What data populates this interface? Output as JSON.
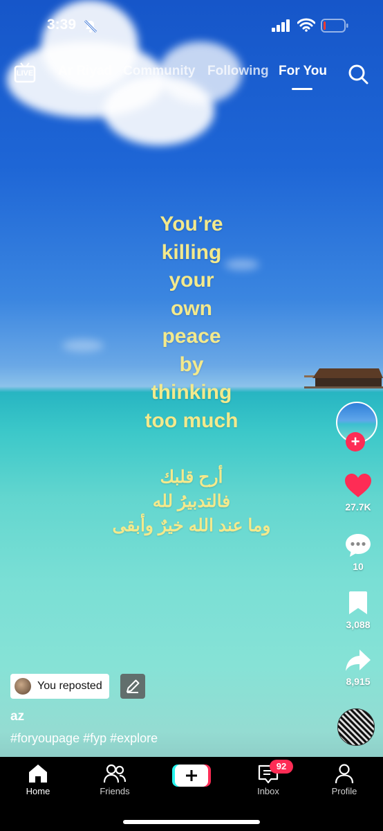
{
  "status_bar": {
    "time": "3:39",
    "icons": [
      "bell-slash-icon",
      "cellular-icon",
      "wifi-icon",
      "battery-icon"
    ]
  },
  "top_nav": {
    "live_label": "LIVE",
    "tabs": [
      {
        "label": "Ar Riyad"
      },
      {
        "label": "Community"
      },
      {
        "label": "Following"
      },
      {
        "label": "For You"
      }
    ]
  },
  "video": {
    "caption_en": [
      "You’re",
      "killing",
      "your",
      "own",
      "peace",
      "by",
      "thinking",
      "too much"
    ],
    "caption_ar": [
      "أرح قلبك",
      "فالتدبيرُ لله",
      "وما عند الله خيرٌ وأبقى"
    ]
  },
  "actions": {
    "likes": "27.7K",
    "comments": "10",
    "saves": "3,088",
    "shares": "8,915"
  },
  "repost": {
    "label": "You reposted"
  },
  "post": {
    "username": "az",
    "hashtags": "#foryoupage #fyp #explore"
  },
  "bottom_nav": {
    "items": [
      {
        "label": "Home"
      },
      {
        "label": "Friends"
      },
      {
        "label": "Inbox"
      },
      {
        "label": "Profile"
      }
    ],
    "inbox_badge": "92"
  },
  "colors": {
    "caption": "#f3e98c",
    "accent": "#fe2c55"
  }
}
